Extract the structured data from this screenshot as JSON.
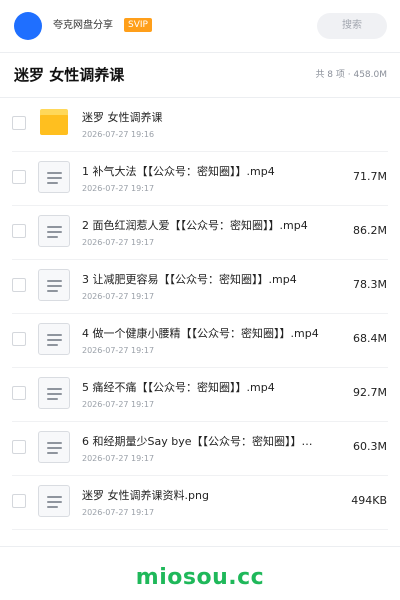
{
  "header": {
    "share_name": "夸克网盘分享",
    "badge": "SVIP",
    "search_placeholder": "搜索"
  },
  "titlebar": {
    "title": "迷罗 女性调养课",
    "summary": "共 8 项 · 458.0M"
  },
  "items": [
    {
      "type": "folder",
      "icon": "folder-icon",
      "name": "迷罗 女性调养课",
      "date": "2026-07-27 19:16",
      "size": ""
    },
    {
      "type": "file",
      "icon": "file-icon",
      "name": "1 补气大法【【公众号：密知圈】】.mp4",
      "date": "2026-07-27 19:17",
      "size": "71.7M"
    },
    {
      "type": "file",
      "icon": "file-icon",
      "name": "2 面色红润惹人爱【【公众号：密知圈】】.mp4",
      "date": "2026-07-27 19:17",
      "size": "86.2M"
    },
    {
      "type": "file",
      "icon": "file-icon",
      "name": "3 让减肥更容易【【公众号：密知圈】】.mp4",
      "date": "2026-07-27 19:17",
      "size": "78.3M"
    },
    {
      "type": "file",
      "icon": "file-icon",
      "name": "4 做一个健康小腰精【【公众号：密知圈】】.mp4",
      "date": "2026-07-27 19:17",
      "size": "68.4M"
    },
    {
      "type": "file",
      "icon": "file-icon",
      "name": "5 痛经不痛【【公众号：密知圈】】.mp4",
      "date": "2026-07-27 19:17",
      "size": "92.7M"
    },
    {
      "type": "file",
      "icon": "file-icon",
      "name": "6 和经期量少Say bye【【公众号：密知圈】】…",
      "date": "2026-07-27 19:17",
      "size": "60.3M"
    },
    {
      "type": "file",
      "icon": "file-icon",
      "name": "迷罗 女性调养课资料.png",
      "date": "2026-07-27 19:17",
      "size": "494KB"
    }
  ],
  "watermark": "miosou.cc",
  "colors": {
    "avatar": "#1f6fff",
    "badge": "#ff9f1a",
    "folder": "#ffbf1f",
    "watermark": "#1fb85a"
  }
}
